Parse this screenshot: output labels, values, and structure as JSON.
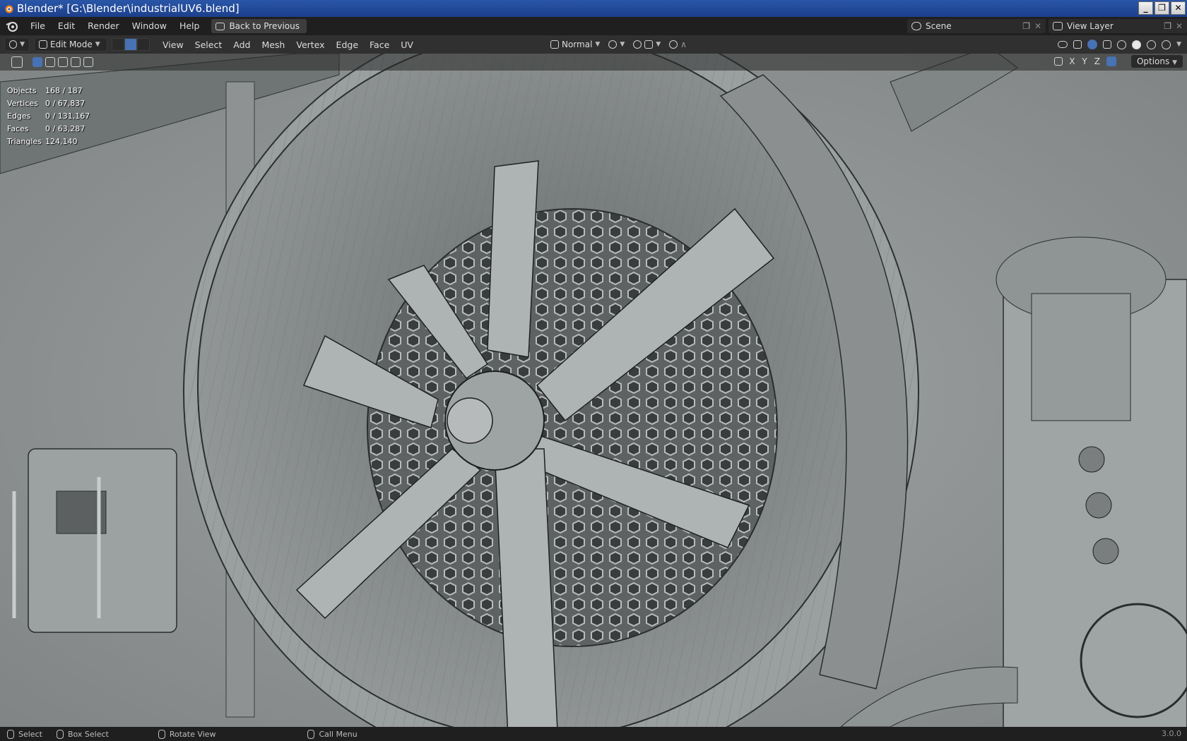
{
  "window": {
    "title": "Blender* [G:\\Blender\\industrialUV6.blend]",
    "buttons": [
      "_",
      "❐",
      "✕"
    ]
  },
  "menubar": {
    "items": [
      "File",
      "Edit",
      "Render",
      "Window",
      "Help"
    ],
    "back_button": "Back to Previous",
    "scene": "Scene",
    "view_layer": "View Layer"
  },
  "header": {
    "mode": "Edit Mode",
    "menus": [
      "View",
      "Select",
      "Add",
      "Mesh",
      "Vertex",
      "Edge",
      "Face",
      "UV"
    ],
    "orientation": "Normal",
    "axes": [
      "X",
      "Y",
      "Z"
    ],
    "options": "Options"
  },
  "stats": [
    {
      "label": "Objects",
      "value": "168 / 187"
    },
    {
      "label": "Vertices",
      "value": "0 / 67,837"
    },
    {
      "label": "Edges",
      "value": "0 / 131,167"
    },
    {
      "label": "Faces",
      "value": "0 / 63,287"
    },
    {
      "label": "Triangles",
      "value": "124,140"
    }
  ],
  "statusbar": {
    "select": "Select",
    "box_select": "Box Select",
    "rotate_view": "Rotate View",
    "call_menu": "Call Menu",
    "version": "3.0.0"
  },
  "colors": {
    "accent": "#4772b3",
    "title_bar": "#2a56a8",
    "viewport": "#8c9090"
  }
}
